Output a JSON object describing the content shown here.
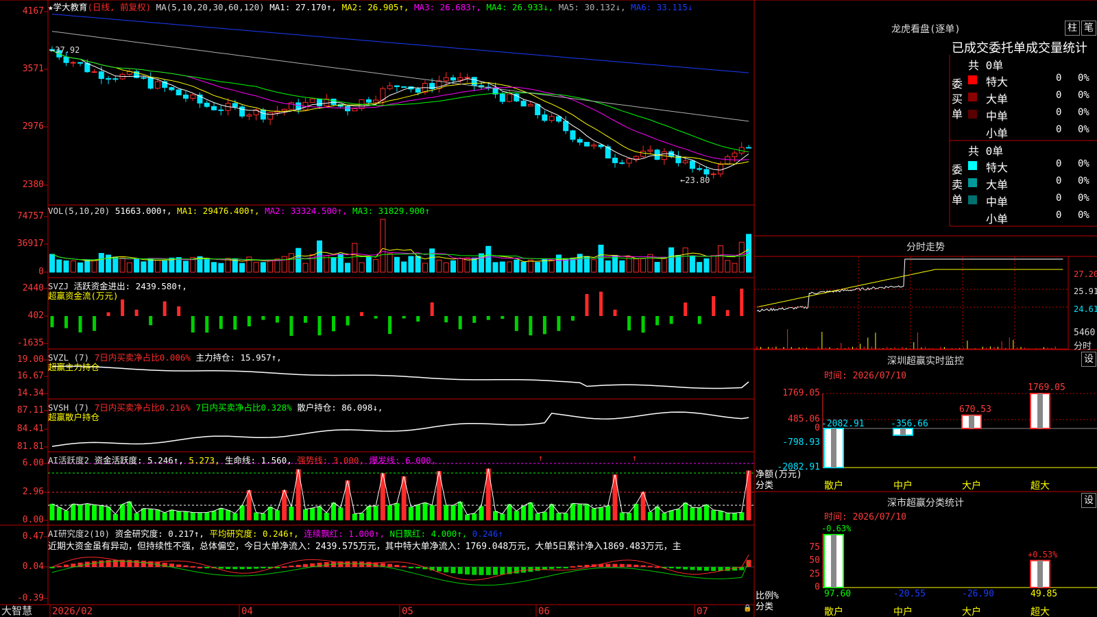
{
  "colors": {
    "up": "#ff2a2a",
    "down": "#00e5ff",
    "frame": "#c00000",
    "white": "#ffffff",
    "yellow": "#ffff00",
    "magenta": "#ff00ff",
    "green": "#00ff00",
    "gray": "#b0b0b0",
    "blue": "#1a3cff",
    "dkgreen": "#00d000"
  },
  "kline": {
    "title": "★学大教育",
    "mode": "(日线, 前复权)",
    "ma_label": "MA(5,10,20,30,60,120)",
    "ma": [
      {
        "t": "MA1: 27.170↑,",
        "c": "#ffffff"
      },
      {
        "t": "MA2: 26.905↑,",
        "c": "#ffff00"
      },
      {
        "t": "MA3: 26.683↑,",
        "c": "#ff00ff"
      },
      {
        "t": "MA4: 26.933↓,",
        "c": "#00ff00"
      },
      {
        "t": "MA5: 30.132↓,",
        "c": "#b0b0b0"
      },
      {
        "t": "MA6: 33.115↓",
        "c": "#1a3cff"
      }
    ],
    "yticks": [
      "4167",
      "3571",
      "2976",
      "2380"
    ],
    "hi_label": "←37.92",
    "lo_label": "←23.80",
    "ymin": 23.0,
    "ymax": 42.0
  },
  "vol": {
    "title": "VOL(5,10,20)",
    "value": "51663.000↑,",
    "ma": [
      {
        "t": "MA1: 29476.400↑,",
        "c": "#ffff00"
      },
      {
        "t": "MA2: 33324.500↑,",
        "c": "#ff00ff"
      },
      {
        "t": "MA3: 31829.900↑",
        "c": "#00ff00"
      }
    ],
    "yticks": [
      "74757",
      "36917",
      "0"
    ]
  },
  "svzj": {
    "title": "SVZJ",
    "item": "活跃资金进出: 2439.580↑,",
    "sub": "超赢资金流(万元)",
    "yticks": [
      "2440",
      "402",
      "-1635"
    ]
  },
  "svzl": {
    "title": "SVZL (7)",
    "item1": "7日内买卖净占比0.006%",
    "item2": "主力持仓: 15.957↑,",
    "sub": "超赢主力持仓",
    "yticks": [
      "19.00",
      "16.67",
      "14.34"
    ]
  },
  "svsh": {
    "title": "SVSH (7)",
    "item1": "7日内买卖净占比0.216%",
    "item2": "7日内买卖净占比0.328%",
    "item3": "散户持仓: 86.098↓,",
    "sub": "超赢散户持仓",
    "yticks": [
      "87.11",
      "84.41",
      "81.81"
    ]
  },
  "ai1": {
    "title": "AI活跃度2",
    "items": [
      {
        "t": "资金活跃度: 5.246↑,",
        "c": "#ffffff"
      },
      {
        "t": "5.273,",
        "c": "#ffff00"
      },
      {
        "t": "生命线: 1.560,",
        "c": "#ffffff"
      },
      {
        "t": "强势线: 3.000,",
        "c": "#ff2a2a"
      },
      {
        "t": "爆发线: 6.000,",
        "c": "#ff00ff"
      }
    ],
    "yticks": [
      "6.00",
      "2.96",
      "0.00"
    ]
  },
  "ai2": {
    "title": "AI研究度2(10)",
    "items": [
      {
        "t": "资金研究度: 0.217↑,",
        "c": "#ffffff"
      },
      {
        "t": "平均研究度: 0.246↑,",
        "c": "#ffff00"
      },
      {
        "t": "连续飘红: 1.000↑,",
        "c": "#ff00ff"
      },
      {
        "t": "N日飘红: 4.000↑,",
        "c": "#00ff00"
      },
      {
        "t": "0.246↑",
        "c": "#1a3cff"
      }
    ],
    "comment": "近期大资金虽有异动，但持续性不强，总体偏空，今日大单净流入：2439.575万元，其中特大单净流入：1769.048万元，大单5日累计净入1869.483万元，主",
    "yticks": [
      "0.47",
      "0.04",
      "-0.39"
    ]
  },
  "xaxis": {
    "labels": [
      "2026/02",
      "04",
      "05",
      "06",
      "07"
    ]
  },
  "brand": "大智慧",
  "longhu": {
    "title": "龙虎看盘(逐单)",
    "btn1": "柱",
    "btn2": "笔",
    "subtitle": "已成交委托单成交量统计",
    "buy": {
      "label": "委买单",
      "total": "共 0单",
      "rows": [
        {
          "name": "特大",
          "v": "0",
          "p": "0%",
          "c": "#ff0000"
        },
        {
          "name": "大单",
          "v": "0",
          "p": "0%",
          "c": "#8b0000"
        },
        {
          "name": "中单",
          "v": "0",
          "p": "0%",
          "c": "#5a0000"
        },
        {
          "name": "小单",
          "v": "0",
          "p": "0%",
          "c": ""
        }
      ]
    },
    "sell": {
      "label": "委卖单",
      "total": "共 0单",
      "rows": [
        {
          "name": "特大",
          "v": "0",
          "p": "0%",
          "c": "#00ffff"
        },
        {
          "name": "大单",
          "v": "0",
          "p": "0%",
          "c": "#009a9a"
        },
        {
          "name": "中单",
          "v": "0",
          "p": "0%",
          "c": "#007070"
        },
        {
          "name": "小单",
          "v": "0",
          "p": "0%",
          "c": ""
        }
      ]
    }
  },
  "intraday": {
    "title": "分时走势",
    "rlabels": [
      "27.20",
      "25.91",
      "24.61"
    ],
    "vol_label": "5460",
    "vol_unit": "分时"
  },
  "szmon": {
    "title": "深圳超赢实时监控",
    "btn": "设",
    "time": "时间: 2026/07/10",
    "yticks": [
      "1769.05",
      "485.06",
      "0",
      "-798.93",
      "-2082.91"
    ],
    "ylabel": "净额(万元)",
    "xlabel": "分类",
    "bars": [
      {
        "cat": "散户",
        "val": -2082.91,
        "label": "-2082.91",
        "color": "#00e5ff"
      },
      {
        "cat": "中户",
        "val": -356.66,
        "label": "-356.66",
        "color": "#00e5ff"
      },
      {
        "cat": "大户",
        "val": 670.53,
        "label": "670.53",
        "color": "#ff2a2a"
      },
      {
        "cat": "超大",
        "val": 1769.05,
        "label": "1769.05",
        "color": "#ff2a2a"
      }
    ],
    "ymin": -2082.91,
    "ymax": 1769.05
  },
  "szcls": {
    "title": "深市超赢分类统计",
    "btn": "设",
    "time": "时间: 2026/07/10",
    "yticks": [
      "75",
      "50",
      "25",
      "0"
    ],
    "ylabel": "比例%",
    "xlabel": "分类",
    "bars": [
      {
        "cat": "散户",
        "top": "-0.63%",
        "val": 97.6,
        "label": "97.60",
        "color": "#00ff00",
        "tc": "#00ff00"
      },
      {
        "cat": "中户",
        "top": "",
        "val": 20.55,
        "label": "-20.55",
        "color": "#00ff00",
        "tc": "#1a3cff"
      },
      {
        "cat": "大户",
        "top": "",
        "val": 26.9,
        "label": "-26.90",
        "color": "#00ff00",
        "tc": "#1a3cff"
      },
      {
        "cat": "超大",
        "top": "+0.53%",
        "val": 49.85,
        "label": "49.85",
        "color": "#ff2a2a",
        "tc": "#ffff00"
      }
    ]
  }
}
